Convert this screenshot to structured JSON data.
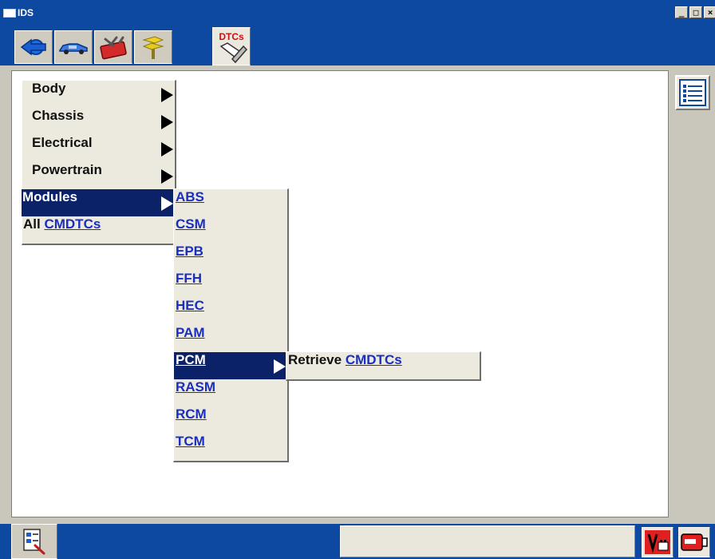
{
  "window": {
    "title": "IDS",
    "controls": [
      "_",
      "□",
      "×"
    ]
  },
  "toolbar": {
    "tabs": [
      {
        "icon": "connect-arrow-icon"
      },
      {
        "icon": "vehicle-icon"
      },
      {
        "icon": "toolbox-icon"
      },
      {
        "icon": "signpost-icon"
      }
    ],
    "active_tab": {
      "icon": "dtcs-icon",
      "label": "DTCs"
    }
  },
  "menu": {
    "main": [
      {
        "label": "Body",
        "has_submenu": true
      },
      {
        "label": "Chassis",
        "has_submenu": true
      },
      {
        "label": "Electrical",
        "has_submenu": true
      },
      {
        "label": "Powertrain",
        "has_submenu": true
      },
      {
        "label": "Modules",
        "has_submenu": true,
        "selected": true
      },
      {
        "prefix": "All",
        "link": "CMDTCs"
      }
    ],
    "modules": [
      "ABS",
      "CSM",
      "EPB",
      "FFH",
      "HEC",
      "PAM",
      "PCM",
      "RASM",
      "RCM",
      "TCM"
    ],
    "selected_module": "PCM",
    "pcm_submenu": {
      "prefix": "Retrieve",
      "link": "CMDTCs"
    }
  },
  "side_button": {
    "icon": "list-icon"
  },
  "bottom": {
    "left_icon": "document-tool-icon",
    "status_text": "",
    "right_icons": [
      "voltage-battery-icon",
      "vmm-connector-icon"
    ]
  },
  "colors": {
    "window_blue": "#0d49a0",
    "menu_bg": "#ece9df",
    "selection": "#0b2268",
    "link": "#1a2ec0"
  }
}
